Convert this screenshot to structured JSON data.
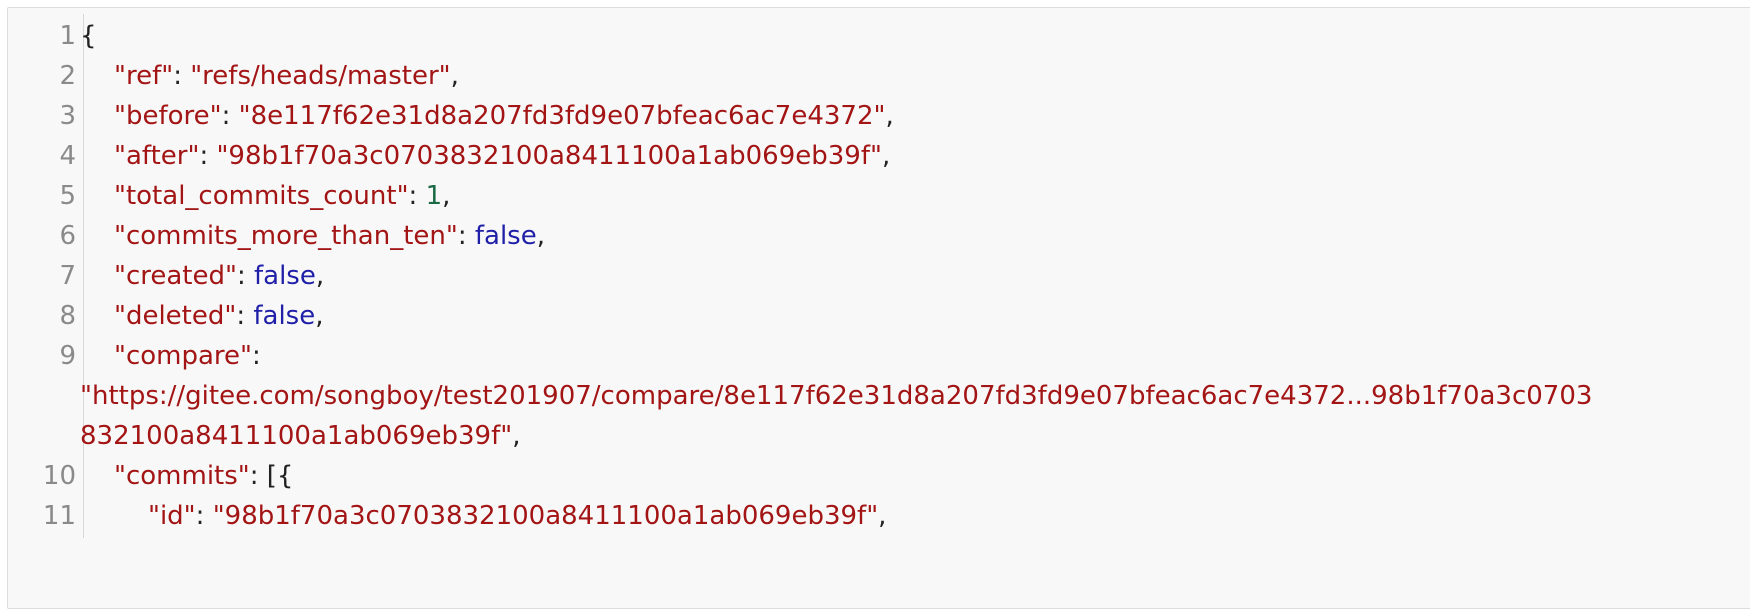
{
  "lines": [
    {
      "num": "1",
      "parts": {
        "a": "{"
      }
    },
    {
      "num": "2",
      "parts": {
        "key": "\"ref\"",
        "colon": ": ",
        "val": "\"refs/heads/master\"",
        "end": ","
      }
    },
    {
      "num": "3",
      "parts": {
        "key": "\"before\"",
        "colon": ": ",
        "val": "\"8e117f62e31d8a207fd3fd9e07bfeac6ac7e4372\"",
        "end": ","
      }
    },
    {
      "num": "4",
      "parts": {
        "key": "\"after\"",
        "colon": ": ",
        "val": "\"98b1f70a3c0703832100a8411100a1ab069eb39f\"",
        "end": ","
      }
    },
    {
      "num": "5",
      "parts": {
        "key": "\"total_commits_count\"",
        "colon": ": ",
        "val": "1",
        "end": ","
      }
    },
    {
      "num": "6",
      "parts": {
        "key": "\"commits_more_than_ten\"",
        "colon": ": ",
        "val": "false",
        "end": ","
      }
    },
    {
      "num": "7",
      "parts": {
        "key": "\"created\"",
        "colon": ": ",
        "val": "false",
        "end": ","
      }
    },
    {
      "num": "8",
      "parts": {
        "key": "\"deleted\"",
        "colon": ": ",
        "val": "false",
        "end": ","
      }
    },
    {
      "num": "9",
      "parts": {
        "key": "\"compare\"",
        "colon": ":"
      }
    },
    {
      "num": "",
      "parts": {
        "val": "\"https://gitee.com/songboy/test201907/compare/8e117f62e31d8a207fd3fd9e07bfeac6ac7e4372...98b1f70a3c0703"
      }
    },
    {
      "num": "",
      "parts": {
        "val": "832100a8411100a1ab069eb39f\"",
        "end": ","
      }
    },
    {
      "num": "10",
      "parts": {
        "key": "\"commits\"",
        "colon": ": ",
        "end": "[{"
      }
    },
    {
      "num": "11",
      "parts": {
        "key": "\"id\"",
        "colon": ": ",
        "val": "\"98b1f70a3c0703832100a8411100a1ab069eb39f\"",
        "end": ","
      }
    }
  ]
}
